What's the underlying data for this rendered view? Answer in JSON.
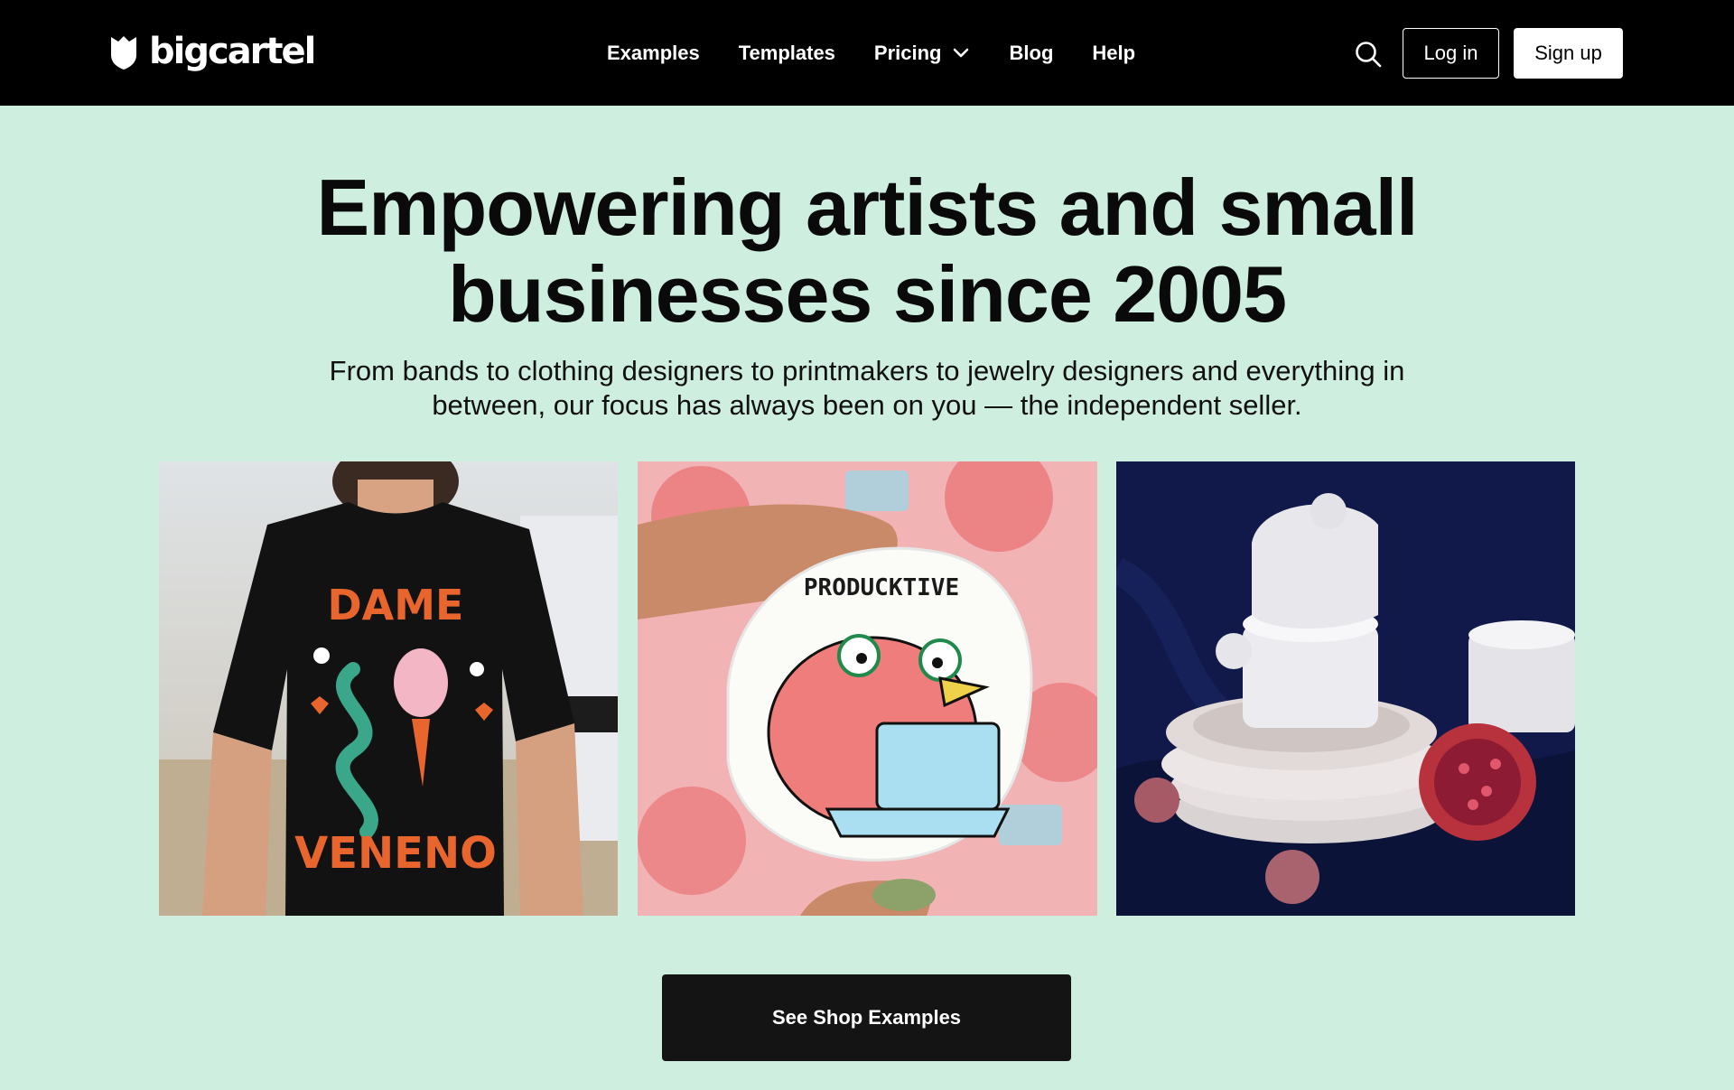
{
  "header": {
    "logo_text": "bigcartel",
    "nav": [
      {
        "label": "Examples"
      },
      {
        "label": "Templates"
      },
      {
        "label": "Pricing",
        "has_dropdown": true
      },
      {
        "label": "Blog"
      },
      {
        "label": "Help"
      }
    ],
    "login_label": "Log in",
    "signup_label": "Sign up"
  },
  "hero": {
    "headline_line1": "Empowering artists and small",
    "headline_line2": "businesses since 2005",
    "subtext_line1": "From bands to clothing designers to printmakers to jewelry designers and everything in",
    "subtext_line2": "between, our focus has always been on you — the independent seller.",
    "cta_label": "See Shop Examples"
  },
  "gallery": {
    "images": [
      {
        "subject": "black t-shirt with orange snake graphic"
      },
      {
        "subject": "hand holding a pink bird sticker"
      },
      {
        "subject": "white ceramic cups and plates with pomegranate"
      }
    ],
    "tile1_text": "DAME VENENO",
    "tile2_text": "PRODUCKTIVE"
  },
  "colors": {
    "header_bg": "#000000",
    "page_bg": "#ceeee0",
    "cta_bg": "#141414"
  }
}
